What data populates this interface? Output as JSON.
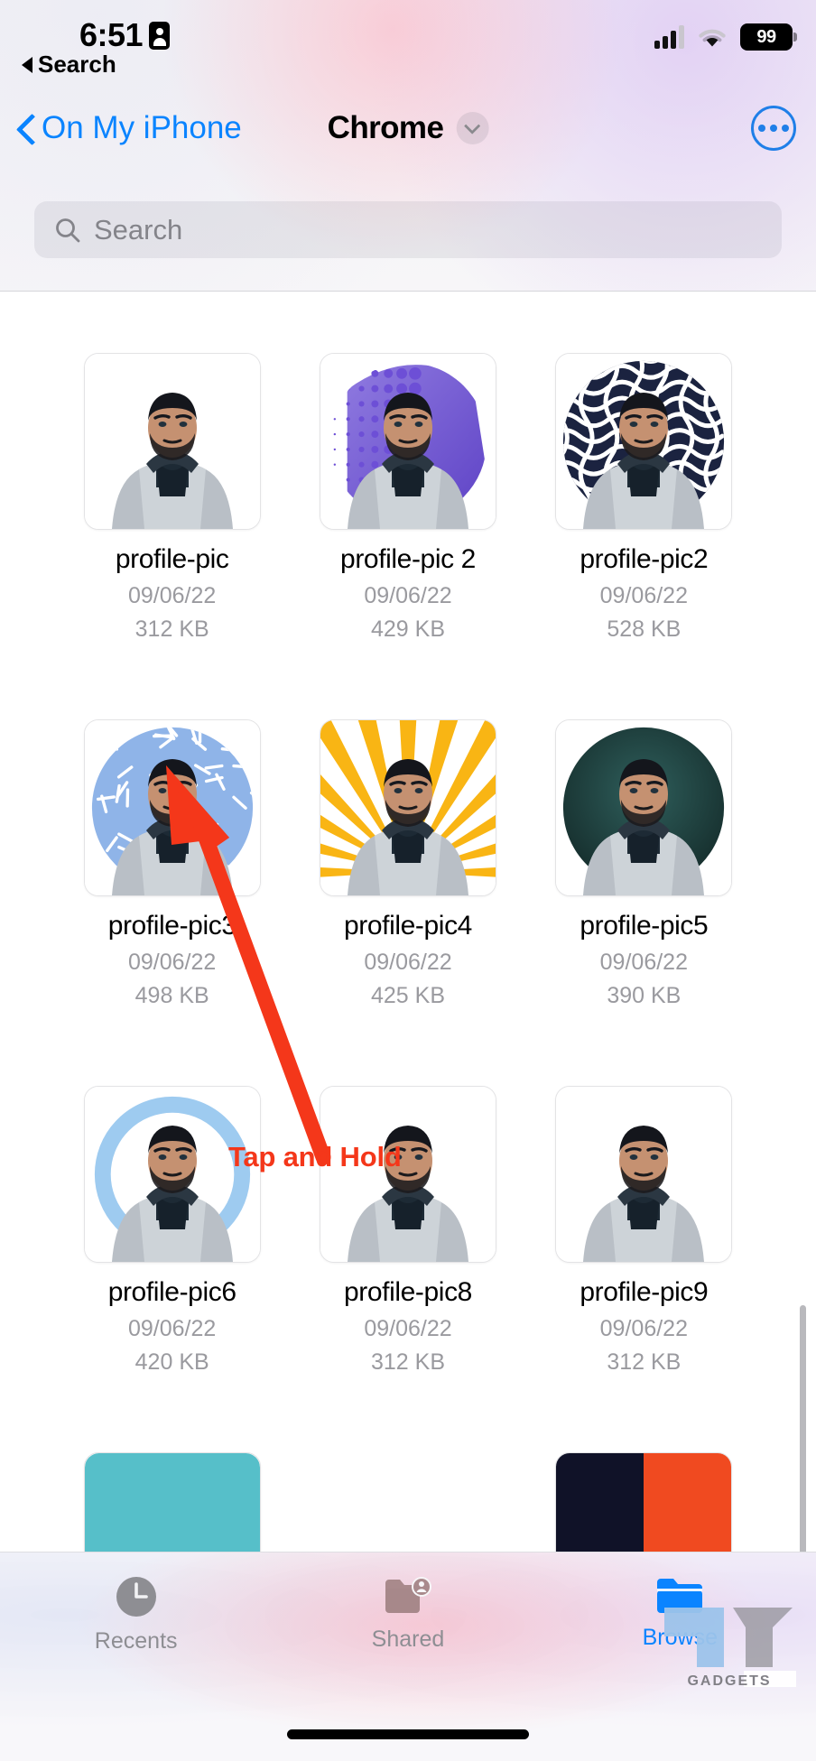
{
  "status_bar": {
    "time": "6:51",
    "id_badge_icon": "id-badge-icon",
    "back_link_label": "Search",
    "back_link_icon": "triangle-left-icon",
    "cellular_icon": "cellular-signal-icon",
    "wifi_icon": "wifi-icon",
    "battery_percent": "99"
  },
  "nav_bar": {
    "back_label": "On My iPhone",
    "back_icon": "chevron-left-icon",
    "title": "Chrome",
    "title_chevron_icon": "chevron-down-icon",
    "more_button_icon": "ellipsis-circle-icon"
  },
  "search": {
    "placeholder": "Search",
    "icon": "search-icon"
  },
  "annotation": {
    "label": "Tap and Hold",
    "color": "#f4371a",
    "arrow_icon": "arrow-up-left-icon"
  },
  "files": [
    {
      "name": "profile-pic",
      "date": "09/06/22",
      "size": "312 KB",
      "bg": "plain"
    },
    {
      "name": "profile-pic 2",
      "date": "09/06/22",
      "size": "429 KB",
      "bg": "halftone-purple"
    },
    {
      "name": "profile-pic2",
      "date": "09/06/22",
      "size": "528 KB",
      "bg": "squiggle-navy"
    },
    {
      "name": "profile-pic3",
      "date": "09/06/22",
      "size": "498 KB",
      "bg": "confetti-blue"
    },
    {
      "name": "profile-pic4",
      "date": "09/06/22",
      "size": "425 KB",
      "bg": "sunburst-yellow"
    },
    {
      "name": "profile-pic5",
      "date": "09/06/22",
      "size": "390 KB",
      "bg": "dark-teal"
    },
    {
      "name": "profile-pic6",
      "date": "09/06/22",
      "size": "420 KB",
      "bg": "ring-lightblue"
    },
    {
      "name": "profile-pic8",
      "date": "09/06/22",
      "size": "312 KB",
      "bg": "plain"
    },
    {
      "name": "profile-pic9",
      "date": "09/06/22",
      "size": "312 KB",
      "bg": "plain"
    }
  ],
  "partial_next_row": [
    {
      "bg": "teal"
    },
    {
      "bg": "none"
    },
    {
      "bg": "navy-orange"
    }
  ],
  "tab_bar": {
    "tabs": [
      {
        "label": "Recents",
        "icon": "clock-icon",
        "active": false
      },
      {
        "label": "Shared",
        "icon": "shared-folder-icon",
        "active": false
      },
      {
        "label": "Browse",
        "icon": "folder-icon",
        "active": true
      }
    ],
    "active_color": "#0a84ff",
    "inactive_color": "#8e8e93"
  },
  "watermark": {
    "text": "GADGETS"
  }
}
